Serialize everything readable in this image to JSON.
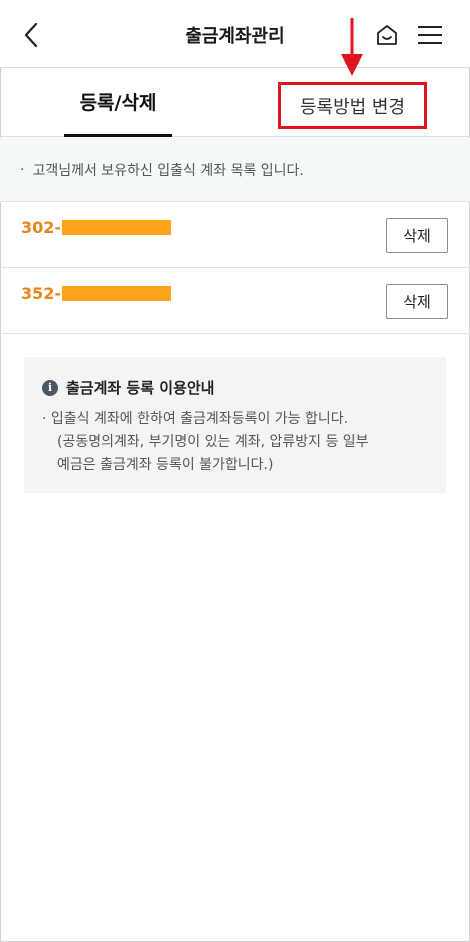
{
  "header": {
    "title": "출금계좌관리",
    "back_icon": "chevron-left-icon",
    "home_icon": "home-icon",
    "menu_icon": "hamburger-menu-icon"
  },
  "tabs": [
    {
      "label": "등록/삭제",
      "active": true
    },
    {
      "label": "등록방법 변경",
      "highlighted": true,
      "highlight_color": "#e0141e"
    }
  ],
  "notice": {
    "bullet": "·",
    "text": "고객님께서 보유하신 입출식 계좌 목록 입니다."
  },
  "accounts": [
    {
      "prefix": "302-",
      "masked": true,
      "delete_label": "삭제"
    },
    {
      "prefix": "352-",
      "masked": true,
      "delete_label": "삭제"
    }
  ],
  "guide": {
    "title": "출금계좌 등록 이용안내",
    "lines": [
      "· 입출식 계좌에 한하여 출금계좌등록이 가능 합니다.",
      "(공동명의계좌, 부기명이 있는 계좌, 압류방지 등 일부",
      "예금은 출금계좌 등록이 불가합니다.)"
    ]
  },
  "colors": {
    "accent_orange": "#e9851c",
    "mask_orange": "#ffa31a",
    "annotation_red": "#e0141e",
    "notice_bg": "#f5faf6"
  }
}
